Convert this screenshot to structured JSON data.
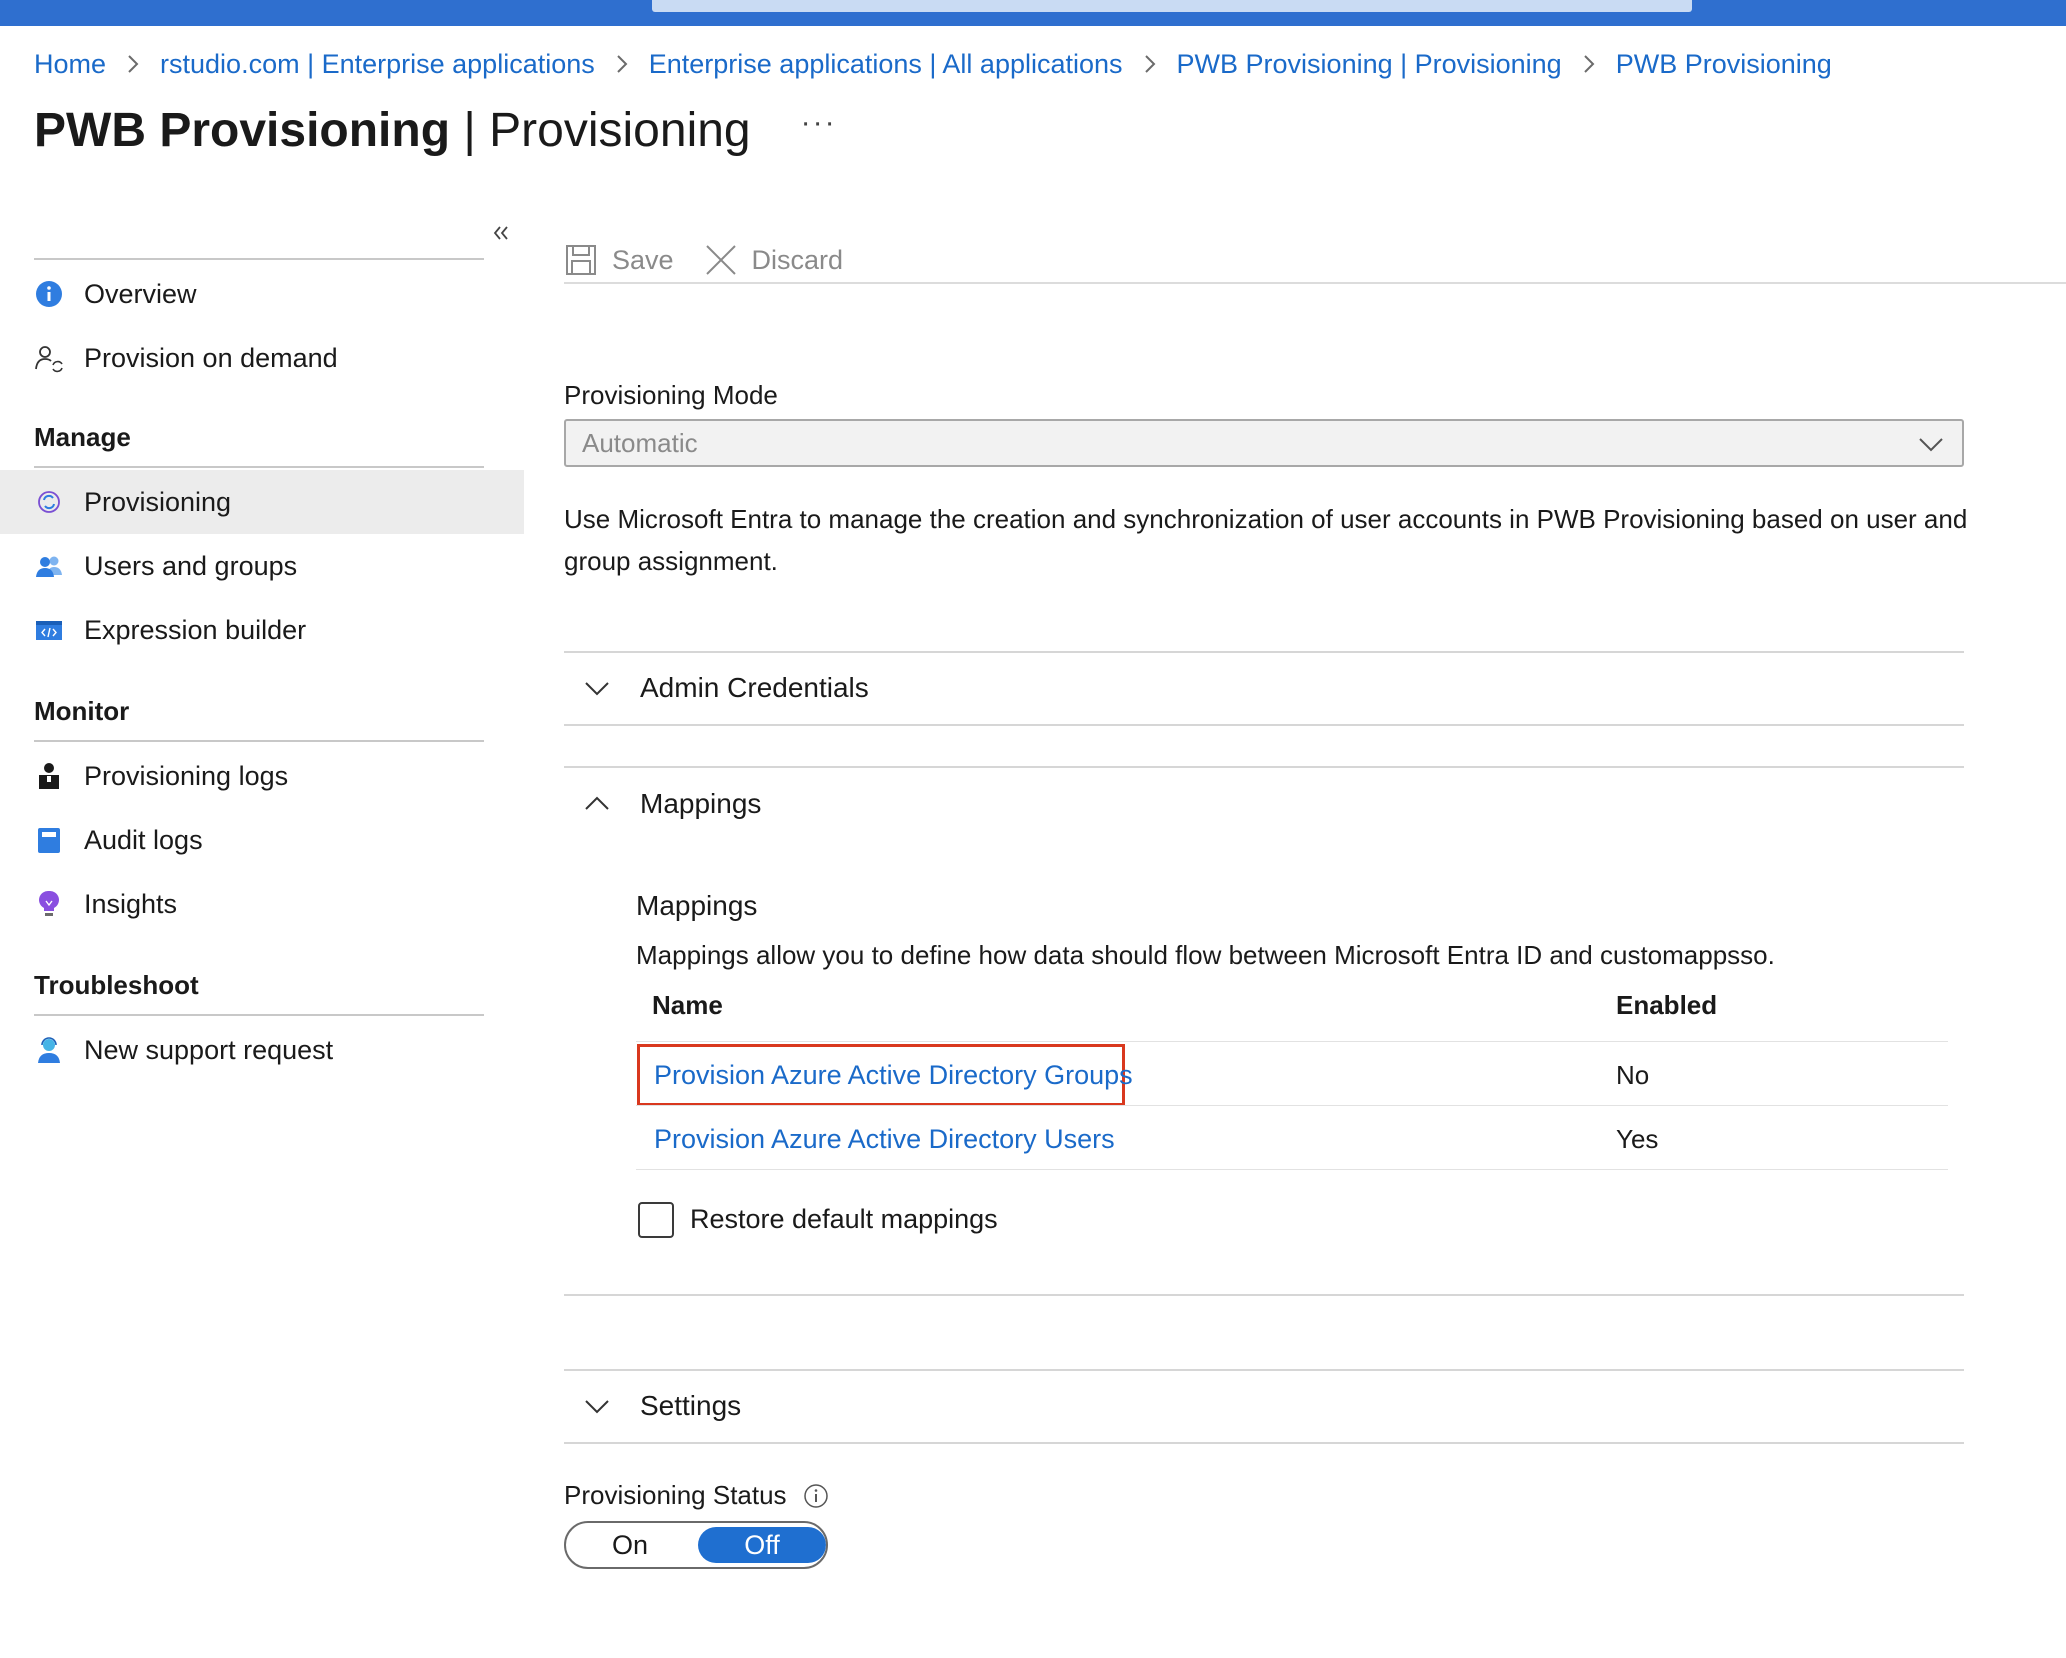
{
  "breadcrumb": [
    "Home",
    "rstudio.com | Enterprise applications",
    "Enterprise applications | All applications",
    "PWB Provisioning | Provisioning",
    "PWB Provisioning"
  ],
  "header": {
    "title_bold": "PWB Provisioning",
    "title_rest": " | Provisioning",
    "more": "···"
  },
  "sidebar": {
    "top_items": [
      {
        "label": "Overview",
        "icon": "info-icon"
      },
      {
        "label": "Provision on demand",
        "icon": "user-sync-icon"
      }
    ],
    "manage_heading": "Manage",
    "manage_items": [
      {
        "label": "Provisioning",
        "icon": "provisioning-icon",
        "active": true
      },
      {
        "label": "Users and groups",
        "icon": "users-icon"
      },
      {
        "label": "Expression builder",
        "icon": "code-window-icon"
      }
    ],
    "monitor_heading": "Monitor",
    "monitor_items": [
      {
        "label": "Provisioning logs",
        "icon": "person-log-icon"
      },
      {
        "label": "Audit logs",
        "icon": "book-icon"
      },
      {
        "label": "Insights",
        "icon": "lightbulb-icon"
      }
    ],
    "troubleshoot_heading": "Troubleshoot",
    "troubleshoot_items": [
      {
        "label": "New support request",
        "icon": "support-person-icon"
      }
    ]
  },
  "toolbar": {
    "save_label": "Save",
    "discard_label": "Discard"
  },
  "provisioning_mode": {
    "label": "Provisioning Mode",
    "value": "Automatic"
  },
  "description": "Use Microsoft Entra to manage the creation and synchronization of user accounts in PWB Provisioning based on user and group assignment.",
  "sections": {
    "admin_credentials": "Admin Credentials",
    "mappings": "Mappings",
    "settings": "Settings"
  },
  "mappings": {
    "title": "Mappings",
    "description": "Mappings allow you to define how data should flow between Microsoft Entra ID and customappsso.",
    "columns": [
      "Name",
      "Enabled"
    ],
    "rows": [
      {
        "name": "Provision Azure Active Directory Groups",
        "enabled": "No"
      },
      {
        "name": "Provision Azure Active Directory Users",
        "enabled": "Yes"
      }
    ],
    "restore_label": "Restore default mappings"
  },
  "provisioning_status": {
    "label": "Provisioning Status",
    "on": "On",
    "off": "Off",
    "selected": "Off"
  },
  "colors": {
    "link": "#1a6ac9",
    "topbar": "#2f6fcf",
    "highlight": "#d9381e",
    "toggle_active": "#1f6fd0"
  }
}
